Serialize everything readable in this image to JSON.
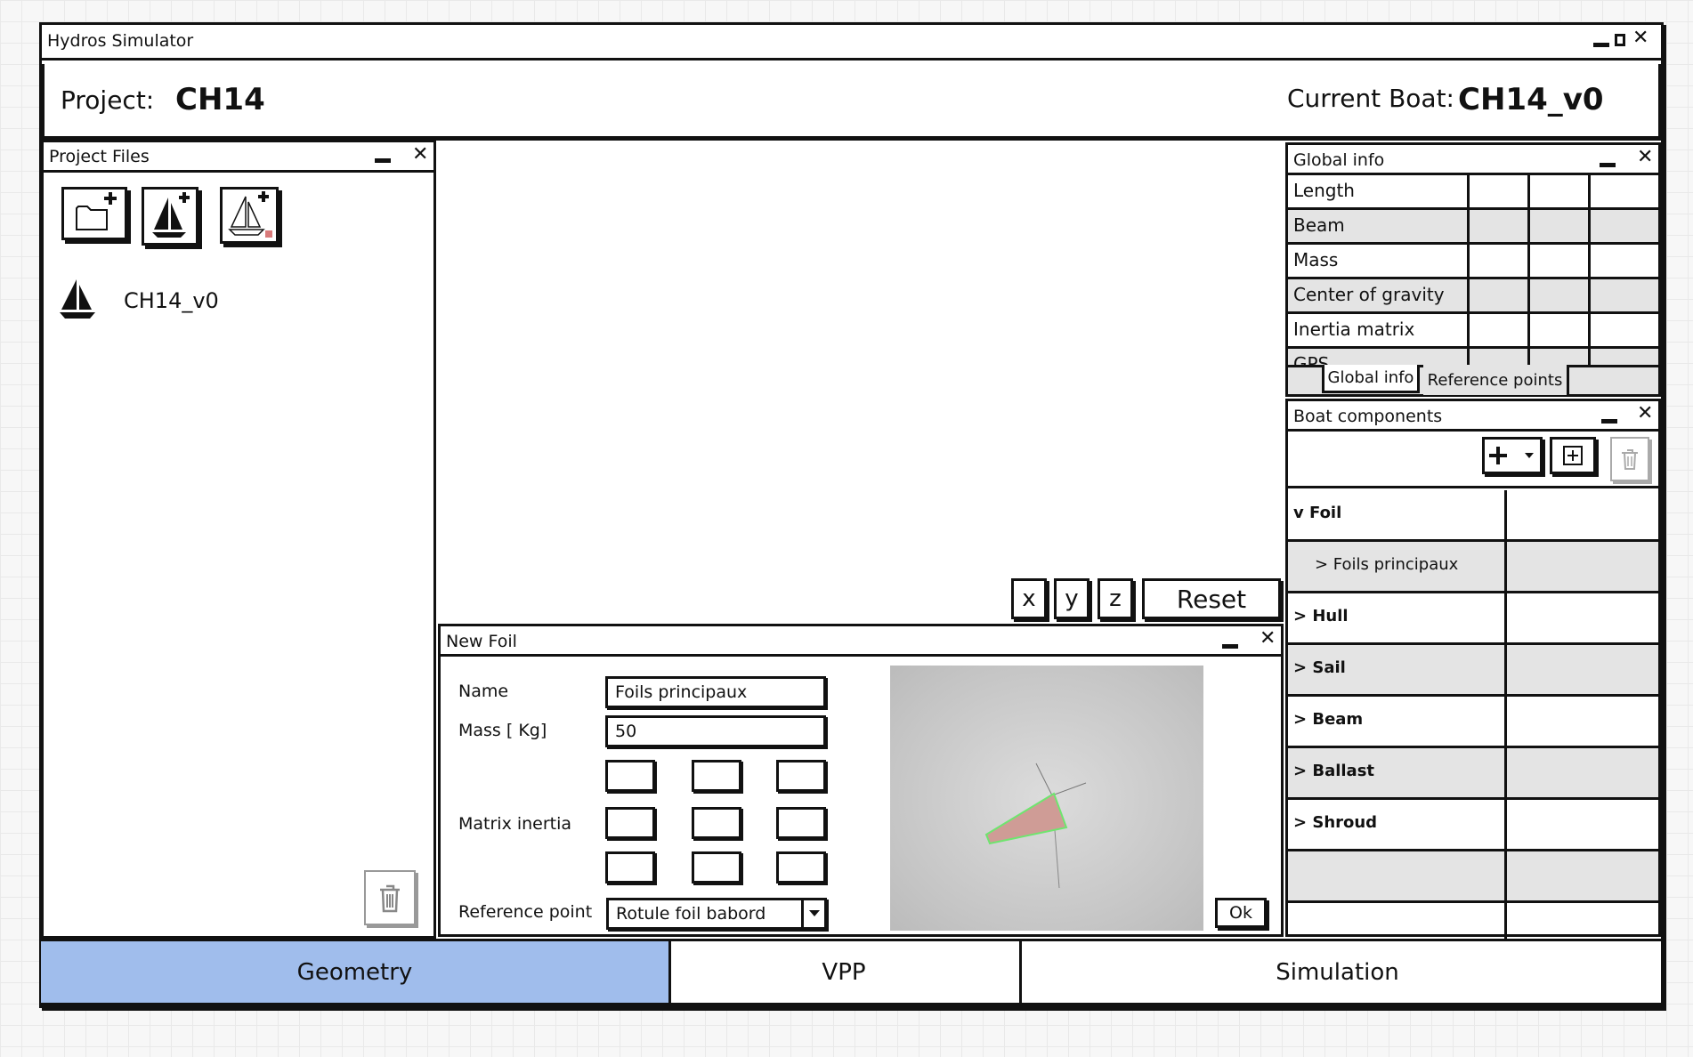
{
  "window": {
    "title": "Hydros Simulator"
  },
  "header": {
    "project_label": "Project:",
    "project_name": "CH14",
    "boat_label": "Current Boat:",
    "boat_name": "CH14_v0"
  },
  "project_files": {
    "title": "Project Files",
    "toolbar_icons": [
      "folder-add-icon",
      "boat-add-icon",
      "boat-sketch-add-icon"
    ],
    "items": [
      {
        "icon": "sailboat-icon",
        "label": "CH14_v0"
      }
    ]
  },
  "viewport": {
    "axis_buttons": [
      "x",
      "y",
      "z"
    ],
    "reset_label": "Reset"
  },
  "new_foil": {
    "title": "New Foil",
    "name_label": "Name",
    "name_value": "Foils principaux",
    "mass_label": "Mass [ Kg]",
    "mass_value": "50",
    "matrix_label": "Matrix inertia",
    "reference_label": "Reference point",
    "reference_value": "Rotule foil babord",
    "ok_label": "Ok"
  },
  "global_info": {
    "title": "Global info",
    "rows": [
      "Length",
      "Beam",
      "Mass",
      "Center of gravity",
      "Inertia matrix",
      "GPS"
    ],
    "tabs": [
      "Global info",
      "Reference points"
    ]
  },
  "boat_components": {
    "title": "Boat components",
    "items": [
      "v Foil",
      "> Foils principaux",
      "> Hull",
      "> Sail",
      "> Beam",
      "> Ballast",
      "> Shroud"
    ]
  },
  "bottom_tabs": {
    "items": [
      "Geometry",
      "VPP",
      "Simulation"
    ],
    "active": "Geometry",
    "active_color": "#a0bdec"
  }
}
